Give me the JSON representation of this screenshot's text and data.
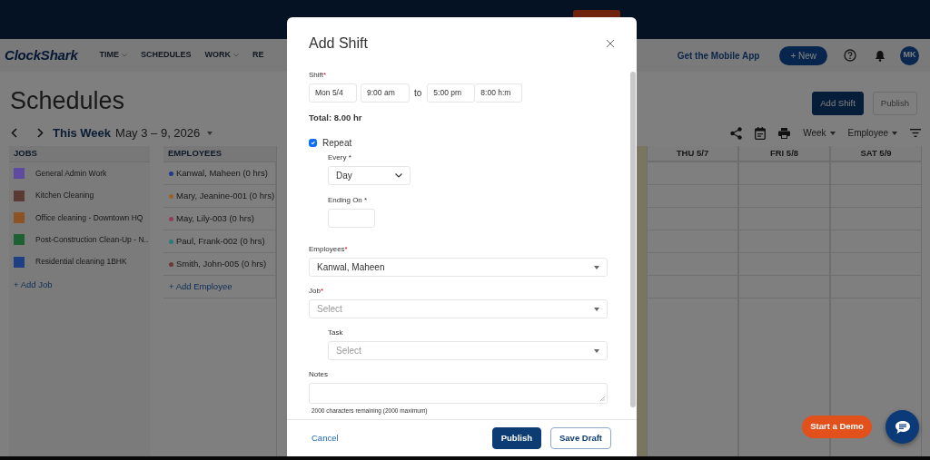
{
  "nav": {
    "logo": "ClockShark",
    "menu": [
      {
        "label": "TIME",
        "dropdown": true
      },
      {
        "label": "SCHEDULES",
        "dropdown": false
      },
      {
        "label": "WORK",
        "dropdown": true
      },
      {
        "label": "RE",
        "dropdown": false
      }
    ],
    "mobile_link": "Get the Mobile App",
    "new_button": "+ New",
    "avatar": "MK"
  },
  "page": {
    "title": "Schedules",
    "buttons": [
      {
        "label": "Add Shift",
        "disabled": false
      },
      {
        "label": "Publish",
        "disabled": true
      }
    ]
  },
  "toolbar": {
    "week_label": "This Week",
    "range": "May 3 – 9, 2026",
    "view": "Week",
    "group": "Employee"
  },
  "jobs": {
    "heading": "JOBS",
    "items": [
      {
        "name": "General Admin Work",
        "color": "#5e4ba0"
      },
      {
        "name": "Kitchen Cleaning",
        "color": "#5a3a33"
      },
      {
        "name": "Office cleaning - Downtown HQ",
        "color": "#8c5426"
      },
      {
        "name": "Post-Construction Clean-Up - N..",
        "color": "#1e5f33"
      },
      {
        "name": "Residential cleaning 1BHK",
        "color": "#1f3f85"
      }
    ],
    "add": "+ Add Job"
  },
  "employees": {
    "heading": "EMPLOYEES",
    "items": [
      {
        "name": "Kanwal, Maheen (0 hrs)",
        "color": "#1a3c8a"
      },
      {
        "name": "Mary, Jeanine-001 (0 hrs)",
        "color": "#9a6328"
      },
      {
        "name": "May, Lily-003 (0 hrs)",
        "color": "#8f3d5b"
      },
      {
        "name": "Paul, Frank-002 (0 hrs)",
        "color": "#2b7a7a"
      },
      {
        "name": "Smith, John-005 (0 hrs)",
        "color": "#6a3a30"
      }
    ],
    "add": "+ Add Employee"
  },
  "days": [
    {
      "label": "THU 5/7"
    },
    {
      "label": "FRI 5/8"
    },
    {
      "label": "SAT 5/9"
    }
  ],
  "modal": {
    "title": "Add Shift",
    "shift": {
      "label": "Shift",
      "required_mark": "*",
      "date": "Mon 5/4",
      "start": "9:00 am",
      "separator": "to",
      "end": "5:00 pm",
      "duration": "8:00 h:m"
    },
    "total": "Total: 8.00 hr",
    "repeat": {
      "label": "Repeat",
      "checked": true
    },
    "every": {
      "label": "Every *",
      "value": "Day"
    },
    "ending_on": {
      "label": "Ending On *"
    },
    "employees": {
      "label": "Employees",
      "required_mark": "*",
      "value": "Kanwal, Maheen"
    },
    "job": {
      "label": "Job",
      "required_mark": "*",
      "placeholder": "Select"
    },
    "task": {
      "label": "Task",
      "placeholder": "Select"
    },
    "notes": {
      "label": "Notes",
      "hint": "2000 characters remaining (2000 maximum)"
    },
    "footer": {
      "cancel": "Cancel",
      "publish": "Publish",
      "save_draft": "Save Draft"
    }
  },
  "demo_button": "Start a Demo"
}
